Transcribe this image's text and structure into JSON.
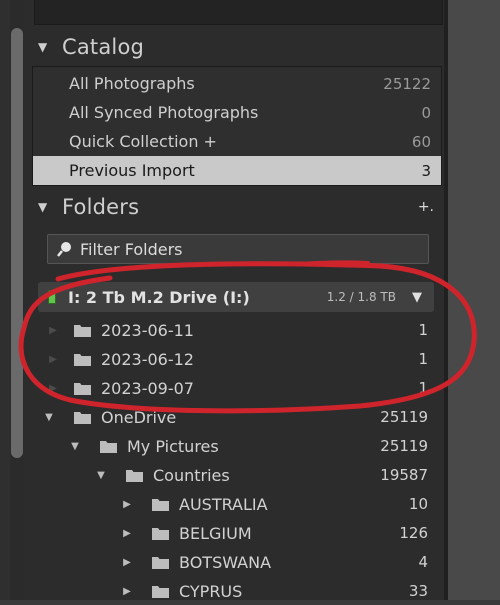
{
  "catalog": {
    "title": "Catalog",
    "items": [
      {
        "label": "All Photographs",
        "count": "25122",
        "selected": false
      },
      {
        "label": "All Synced Photographs",
        "count": "0",
        "selected": false
      },
      {
        "label": "Quick Collection +",
        "count": "60",
        "selected": false
      },
      {
        "label": "Previous Import",
        "count": "3",
        "selected": true
      }
    ]
  },
  "folders": {
    "title": "Folders",
    "add_icon": "plus-icon",
    "filter_placeholder": "Filter Folders",
    "drive": {
      "name": "I: 2 Tb M.2 Drive (I:)",
      "size": "1.2 / 1.8 TB",
      "status_color": "#66c24f"
    },
    "tree": [
      {
        "label": "2023-06-11",
        "count": "1"
      },
      {
        "label": "2023-06-12",
        "count": "1"
      },
      {
        "label": "2023-09-07",
        "count": "1"
      },
      {
        "label": "OneDrive",
        "count": "25119"
      },
      {
        "label": "My Pictures",
        "count": "25119"
      },
      {
        "label": "Countries",
        "count": "19587"
      },
      {
        "label": "AUSTRALIA",
        "count": "10"
      },
      {
        "label": "BELGIUM",
        "count": "126"
      },
      {
        "label": "BOTSWANA",
        "count": "4"
      },
      {
        "label": "CYPRUS",
        "count": "33"
      }
    ]
  },
  "colors": {
    "selected_row": "#c9c9c9",
    "panel": "#2c2c2c",
    "annotation": "#d0242c"
  }
}
